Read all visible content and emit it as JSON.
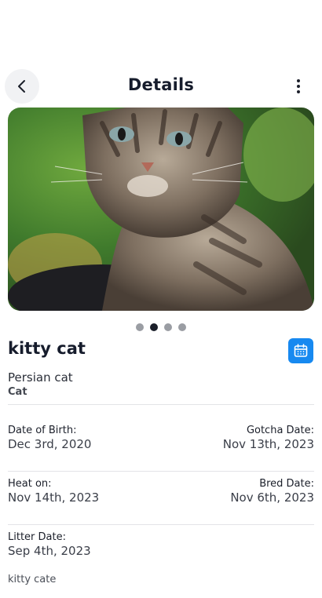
{
  "header": {
    "title": "Details",
    "back_icon": "chevron-left-icon",
    "menu_icon": "vertical-ellipsis-icon"
  },
  "gallery": {
    "image_subject": "tabby kitten photo",
    "count": 4,
    "active_index": 1
  },
  "pet": {
    "name": "kitty cat",
    "breed": "Persian cat",
    "species": "Cat",
    "calendar_icon": "calendar-icon"
  },
  "dates": {
    "birth_label": "Date of Birth:",
    "birth_value": "Dec 3rd, 2020",
    "gotcha_label": "Gotcha Date:",
    "gotcha_value": "Nov 13th, 2023",
    "heat_label": "Heat on:",
    "heat_value": "Nov 14th, 2023",
    "bred_label": "Bred Date:",
    "bred_value": "Nov 6th, 2023",
    "litter_label": "Litter Date:",
    "litter_value": "Sep 4th, 2023"
  },
  "notes": "kitty cate",
  "colors": {
    "accent": "#1789f0",
    "text": "#1b1f2a",
    "divider": "#e3e4e7"
  }
}
